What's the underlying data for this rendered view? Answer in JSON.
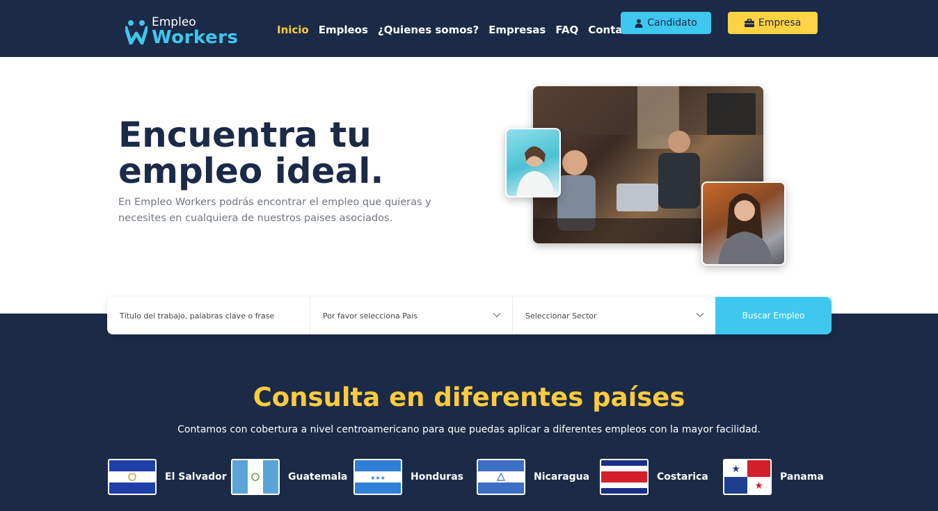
{
  "brand": {
    "logo_top": "Empleo",
    "logo_main": "Workers"
  },
  "nav": [
    {
      "label": "Inicio",
      "active": true
    },
    {
      "label": "Empleos",
      "active": false
    },
    {
      "label": "¿Quienes somos?",
      "active": false
    },
    {
      "label": "Empresas",
      "active": false
    },
    {
      "label": "FAQ",
      "active": false
    },
    {
      "label": "Contacto",
      "active": false
    }
  ],
  "header_buttons": {
    "candidato": "Candidato",
    "empresa": "Empresa"
  },
  "hero": {
    "title": "Encuentra tu empleo ideal.",
    "subtitle": "En Empleo Workers podrás encontrar el empleo que quieras y necesites en cualquiera de nuestros paises asociados."
  },
  "search": {
    "keyword_placeholder": "Título del trabajo, palabras clave o frase",
    "country_select": "Por favor selecciona Pais",
    "sector_select": "Seleccionar Sector",
    "button": "Buscar Empleo"
  },
  "countries_section": {
    "title": "Consulta en diferentes países",
    "subtitle": "Contamos con cobertura a nivel centroamericano para que puedas aplicar a diferentes empleos con la mayor facilidad.",
    "countries": [
      "El Salvador",
      "Guatemala",
      "Honduras",
      "Nicaragua",
      "Costarica",
      "Panama"
    ]
  },
  "colors": {
    "navy": "#1b2a47",
    "cyan": "#3ec8f0",
    "yellow": "#fecb3d"
  }
}
